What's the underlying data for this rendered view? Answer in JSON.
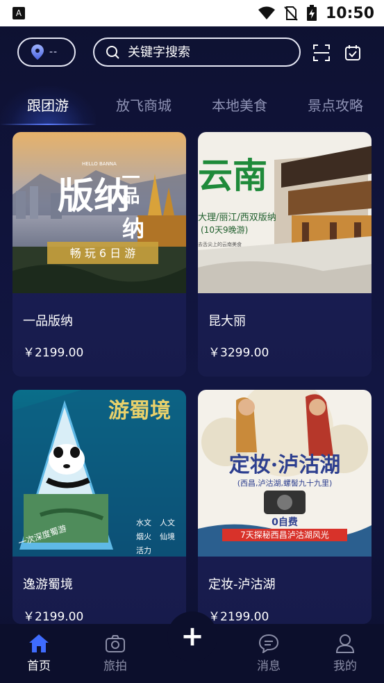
{
  "status_bar": {
    "time": "10:50",
    "icons": [
      "android-a-icon",
      "wifi-icon",
      "no-sim-icon",
      "battery-charging-icon"
    ]
  },
  "header": {
    "location_text": "--",
    "search_placeholder": "关键字搜索",
    "scan_icon": "scan-icon",
    "calendar_icon": "calendar-check-icon"
  },
  "tabs": [
    {
      "label": "跟团游",
      "active": true
    },
    {
      "label": "放飞商城",
      "active": false
    },
    {
      "label": "本地美食",
      "active": false
    },
    {
      "label": "景点攻略",
      "active": false
    }
  ],
  "products": [
    {
      "title": "一品版纳",
      "price": "￥2199.00",
      "poster": {
        "headline": "版纳",
        "side": "一品",
        "tail": "纳",
        "small": "HELLO BANNA",
        "ribbon": "畅 玩 6 日 游"
      }
    },
    {
      "title": "昆大丽",
      "price": "￥3299.00",
      "poster": {
        "headline": "云南",
        "line1": "大理/丽江/西双版纳",
        "line2": "(10天9晚游)",
        "line3": "去舌尖上的云南美食"
      }
    },
    {
      "title": "逸游蜀境",
      "price": "￥2199.00",
      "poster": {
        "headline": "游蜀境",
        "corner": "一次深度蜀游",
        "notes": [
          "水文",
          "人文",
          "烟火",
          "仙境",
          "活力"
        ]
      }
    },
    {
      "title": "定妆-泸沽湖",
      "price": "￥2199.00",
      "poster": {
        "headline": "定妆·泸沽湖",
        "sub": "(西昌,泸沽湖,螺髻九十九里)",
        "badge": "0自费",
        "bar": "7天探秘西昌泸沽湖风光"
      }
    }
  ],
  "fab_label": "+",
  "bottom_nav": [
    {
      "label": "首页",
      "icon": "home-icon",
      "active": true
    },
    {
      "label": "旅拍",
      "icon": "camera-icon",
      "active": false
    },
    {
      "label": "消息",
      "icon": "chat-bubble-icon",
      "active": false
    },
    {
      "label": "我的",
      "icon": "user-icon",
      "active": false
    }
  ],
  "colors": {
    "background": "#121643",
    "card": "#1c1f5b",
    "active_tab_glow": "#5d7dff",
    "nav_active": "#3f6cff",
    "nav_inactive": "#8c8fa8"
  }
}
